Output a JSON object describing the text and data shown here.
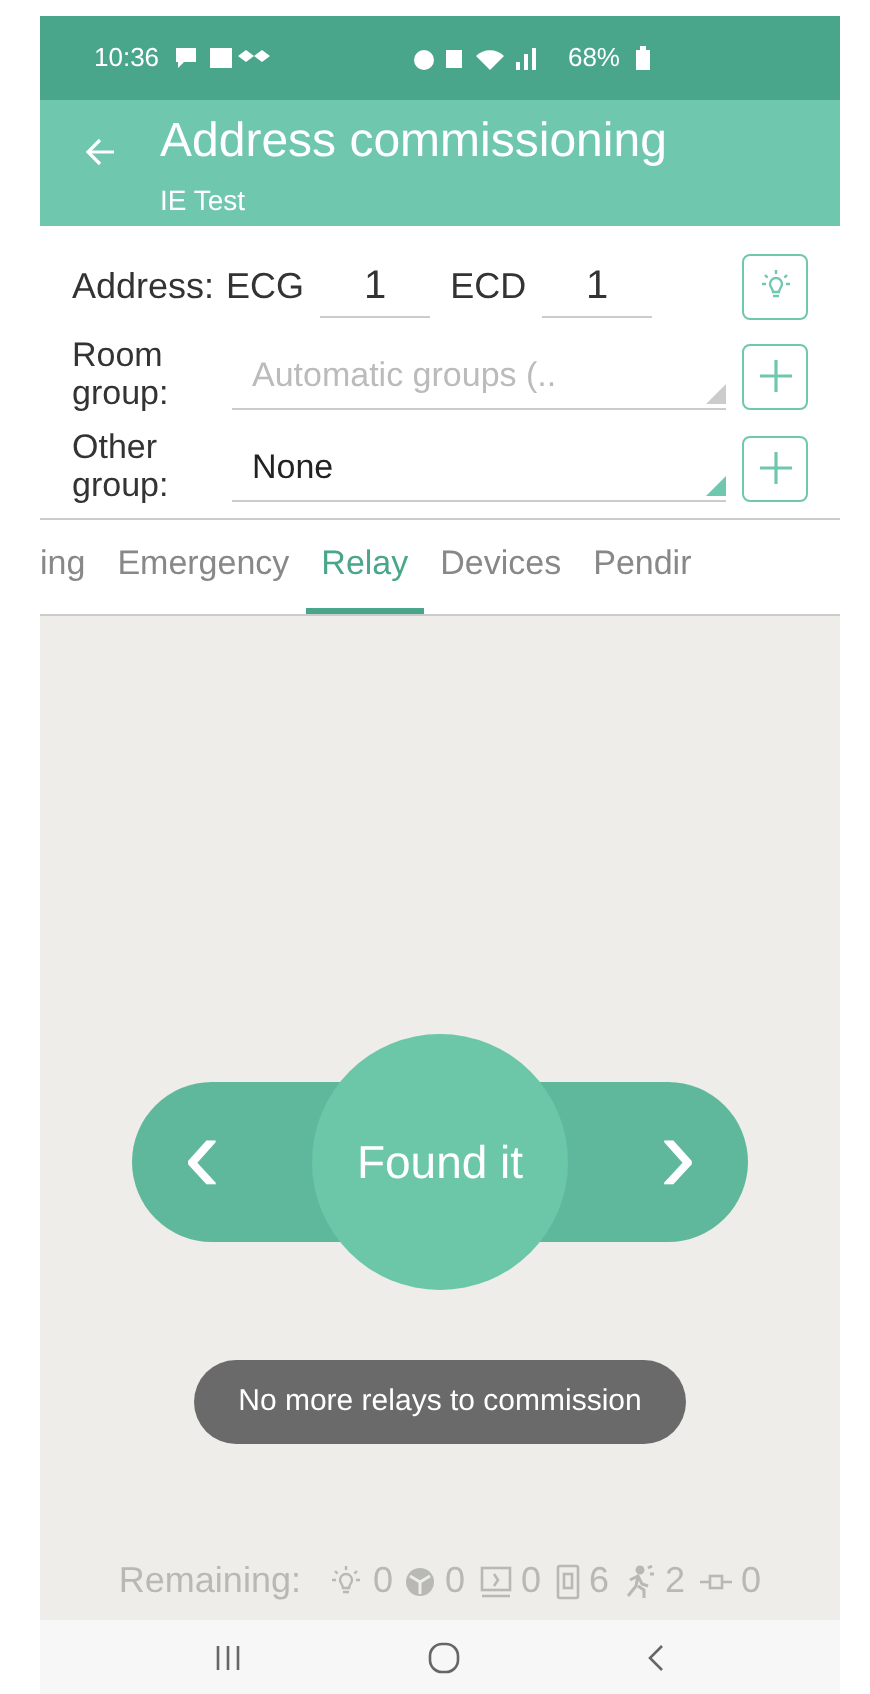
{
  "status_bar": {
    "time": "10:36",
    "battery": "68%"
  },
  "app_bar": {
    "title": "Address commissioning",
    "subtitle": "IE Test"
  },
  "address": {
    "label": "Address:",
    "fields": [
      {
        "label": "ECG",
        "value": "1"
      },
      {
        "label": "ECD",
        "value": "1"
      }
    ]
  },
  "groups": [
    {
      "label": "Room group:",
      "value": "Automatic groups (..",
      "disabled": true
    },
    {
      "label": "Other group:",
      "value": "None",
      "disabled": false
    }
  ],
  "tabs": [
    {
      "label": "ing",
      "selected": false
    },
    {
      "label": "Emergency",
      "selected": false
    },
    {
      "label": "Relay",
      "selected": true
    },
    {
      "label": "Devices",
      "selected": false
    },
    {
      "label": "Pendir",
      "selected": false
    }
  ],
  "finder": {
    "label": "Found it",
    "prev": "‹",
    "next": "›"
  },
  "toast": "No more relays to commission",
  "remaining": {
    "label": "Remaining:",
    "items": [
      {
        "kind": "lamp",
        "count": "0"
      },
      {
        "kind": "ball",
        "count": "0"
      },
      {
        "kind": "exit",
        "count": "0"
      },
      {
        "kind": "relay",
        "count": "6"
      },
      {
        "kind": "motion",
        "count": "2"
      },
      {
        "kind": "plug",
        "count": "0"
      }
    ]
  }
}
